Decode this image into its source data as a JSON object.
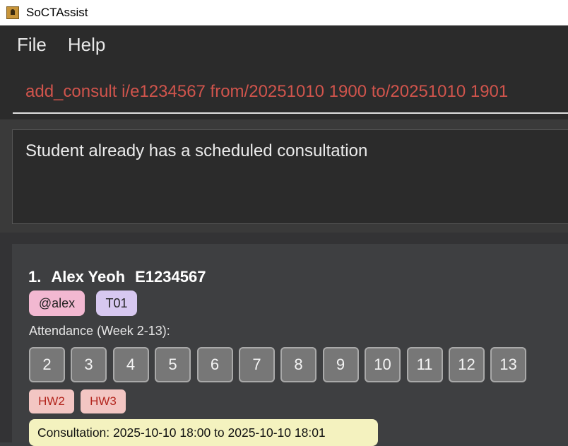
{
  "window": {
    "title": "SoCTAssist",
    "icon": "app-icon"
  },
  "menu": {
    "file": "File",
    "help": "Help"
  },
  "command": {
    "text": "add_consult i/e1234567 from/20251010 1900 to/20251010 1901"
  },
  "result": {
    "text": "Student already has a scheduled consultation"
  },
  "students": [
    {
      "index": "1.",
      "name": "Alex Yeoh",
      "id": "E1234567",
      "telegram": "@alex",
      "tutorial": "T01",
      "attendance_label": "Attendance (Week 2-13):",
      "weeks": [
        "2",
        "3",
        "4",
        "5",
        "6",
        "7",
        "8",
        "9",
        "10",
        "11",
        "12",
        "13"
      ],
      "homework": [
        "HW2",
        "HW3"
      ],
      "consultation": "Consultation: 2025-10-10 18:00 to 2025-10-10 18:01"
    }
  ],
  "colors": {
    "command_text": "#d0544c",
    "tag_telegram": "#f2b8d1",
    "tag_tutorial": "#d7c8f0",
    "homework_bg": "#f3c6c3",
    "homework_text": "#b3261e",
    "consultation_bg": "#f4f2bf"
  }
}
